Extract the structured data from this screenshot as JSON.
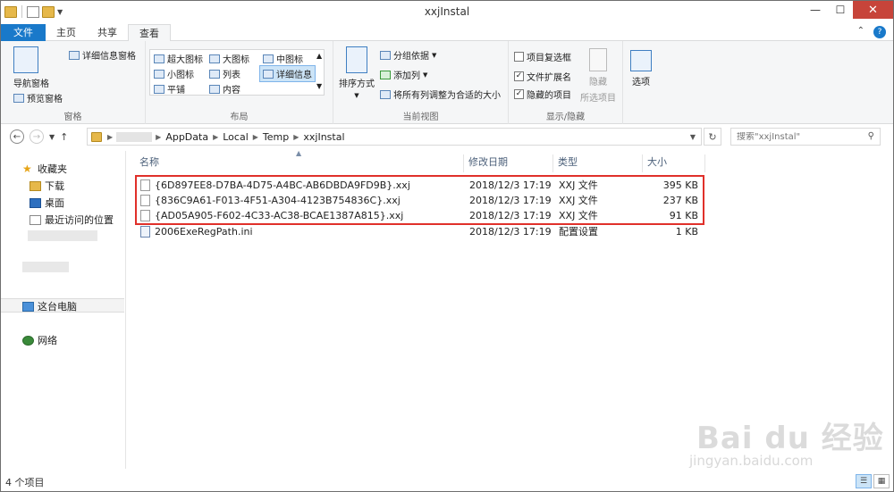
{
  "window": {
    "title": "xxjInstal"
  },
  "ribbon_tabs": [
    {
      "label": "文件"
    },
    {
      "label": "主页"
    },
    {
      "label": "共享"
    },
    {
      "label": "查看"
    }
  ],
  "ribbon": {
    "pane_group": {
      "nav_pane": "导航窗格",
      "preview_pane": "预览窗格",
      "details_pane": "详细信息窗格",
      "label": "窗格"
    },
    "layout_group": {
      "items": [
        "超大图标",
        "大图标",
        "中图标",
        "小图标",
        "列表",
        "详细信息",
        "平铺",
        "内容"
      ],
      "label": "布局"
    },
    "current_view_group": {
      "sort": "排序方式",
      "group_by": "分组依据",
      "add_column": "添加列",
      "fit_columns": "将所有列调整为合适的大小",
      "label": "当前视图"
    },
    "show_hide_group": {
      "item_checkbox": "项目复选框",
      "file_ext": "文件扩展名",
      "hidden_items": "隐藏的项目",
      "hide": "隐藏",
      "selected_items": "所选项目",
      "label": "显示/隐藏"
    },
    "options": "选项"
  },
  "address": {
    "crumbs": [
      "AppData",
      "Local",
      "Temp",
      "xxjInstal"
    ],
    "search_placeholder": "搜索\"xxjInstal\""
  },
  "nav_pane": {
    "favorites": "收藏夹",
    "downloads": "下载",
    "desktop": "桌面",
    "recent": "最近访问的位置",
    "this_pc": "这台电脑",
    "network": "网络"
  },
  "columns": {
    "name": "名称",
    "modified": "修改日期",
    "type": "类型",
    "size": "大小"
  },
  "files": [
    {
      "name": "{6D897EE8-D7BA-4D75-A4BC-AB6DBDA9FD9B}.xxj",
      "modified": "2018/12/3 17:19",
      "type": "XXJ 文件",
      "size": "395 KB"
    },
    {
      "name": "{836C9A61-F013-4F51-A304-4123B754836C}.xxj",
      "modified": "2018/12/3 17:19",
      "type": "XXJ 文件",
      "size": "237 KB"
    },
    {
      "name": "{AD05A905-F602-4C33-AC38-BCAE1387A815}.xxj",
      "modified": "2018/12/3 17:19",
      "type": "XXJ 文件",
      "size": "91 KB"
    },
    {
      "name": "2006ExeRegPath.ini",
      "modified": "2018/12/3 17:19",
      "type": "配置设置",
      "size": "1 KB"
    }
  ],
  "status": {
    "count": "4 个项目"
  },
  "watermark": {
    "text": "Bai du 经验",
    "url": "jingyan.baidu.com"
  }
}
